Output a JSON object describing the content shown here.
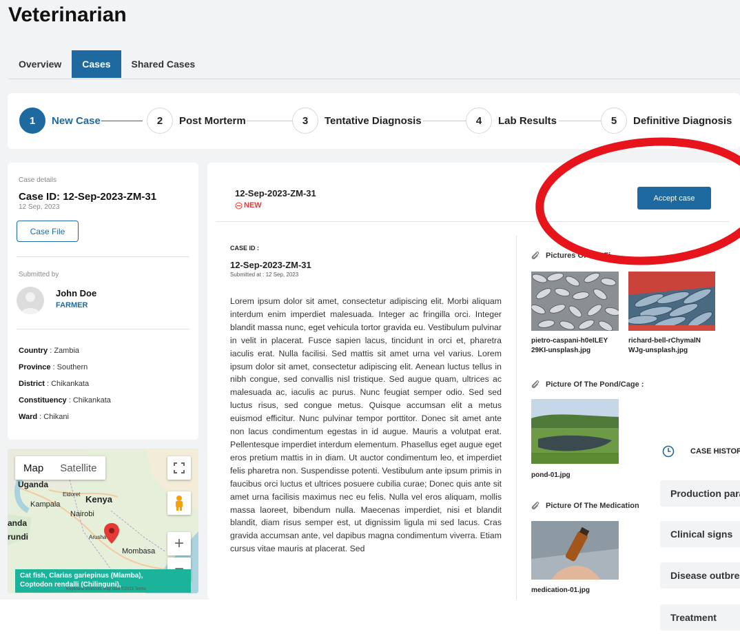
{
  "page": {
    "title": "Veterinarian"
  },
  "tabs": [
    {
      "label": "Overview"
    },
    {
      "label": "Cases"
    },
    {
      "label": "Shared Cases"
    }
  ],
  "steps": [
    {
      "num": "1",
      "label": "New Case"
    },
    {
      "num": "2",
      "label": "Post Morterm"
    },
    {
      "num": "3",
      "label": "Tentative Diagnosis"
    },
    {
      "num": "4",
      "label": "Lab Results"
    },
    {
      "num": "5",
      "label": "Definitive Diagnosis"
    }
  ],
  "left": {
    "details_label": "Case details",
    "case_id_title": "Case ID: 12-Sep-2023-ZM-31",
    "date": "12 Sep, 2023",
    "case_file_button": "Case File",
    "submitted_by_label": "Submitted by",
    "user_name": "John Doe",
    "user_role": "FARMER",
    "location": [
      {
        "key": "Country",
        "value": "Zambia"
      },
      {
        "key": "Province",
        "value": "Southern"
      },
      {
        "key": "District",
        "value": "Chikankata"
      },
      {
        "key": "Constituency",
        "value": "Chikankata"
      },
      {
        "key": "Ward",
        "value": "Chikani"
      }
    ]
  },
  "map": {
    "tab_map": "Map",
    "tab_satellite": "Satellite",
    "labels": {
      "uganda": "Uganda",
      "eldoret": "Eldoret",
      "kenya": "Kenya",
      "kampala": "Kampala",
      "nairobi": "Nairobi",
      "rwanda": "anda",
      "burundi": "rundi",
      "arusha": "Arusha",
      "mombasa": "Mombasa"
    },
    "info_lines": [
      "Cat fish, Clarias gariepinus (Mlamba),",
      "Coptodon rendalli (Chilinguni),"
    ],
    "footer_text": "Keyboard shortcuts   Map data ©2023   Terms",
    "accent_pin": "#e53935"
  },
  "main": {
    "case_id": "12-Sep-2023-ZM-31",
    "status": "NEW",
    "accept_button": "Accept case",
    "case_id_label": "CASE ID :",
    "case_id_value": "12-Sep-2023-ZM-31",
    "submitted_at": "Submitted at : 12 Sep, 2023",
    "body": "Lorem ipsum dolor sit amet, consectetur adipiscing elit. Morbi aliquam interdum enim imperdiet malesuada. Integer ac fringilla orci. Integer blandit massa nunc, eget vehicula tortor gravida eu. Vestibulum pulvinar in velit in placerat. Fusce sapien lacus, tincidunt in orci et, pharetra iaculis erat. Nulla facilisi. Sed mattis sit amet urna vel varius. Lorem ipsum dolor sit amet, consectetur adipiscing elit. Aenean luctus tellus in nibh congue, sed convallis nisl tristique. Sed augue quam, ultrices ac malesuada ac, iaculis ac purus. Nunc feugiat semper odio. Sed sed luctus risus, sed congue metus. Quisque accumsan elit a metus euismod efficitur. Nunc pulvinar tempor porttitor. Donec sit amet ante non lacus condimentum egestas in id augue. Mauris a volutpat erat. Pellentesque imperdiet interdum elementum. Phasellus eget augue eget eros pretium mattis in in diam. Ut auctor condimentum leo, et imperdiet felis pharetra non. Suspendisse potenti. Vestibulum ante ipsum primis in faucibus orci luctus et ultrices posuere cubilia curae; Donec quis ante sit amet urna facilisis maximus nec eu felis. Nulla vel eros aliquam, mollis massa laoreet, bibendum nulla. Maecenas imperdiet, nisi et blandit blandit, diam risus semper est, ut dignissim ligula mi sed lacus. Cras gravida accumsan ante, vel dapibus magna condimentum viverra. Etiam cursus vitae mauris at placerat. Sed",
    "attachments": {
      "fish_heading": "Pictures Of The Fi",
      "fish_files": [
        "pietro-caspani-h0eILEY29KI-unsplash.jpg",
        "richard-bell-rChymalNWJg-unsplash.jpg"
      ],
      "fish_file1_lines": [
        "pietro-caspani-h0eILEY",
        "29KI-unsplash.jpg"
      ],
      "fish_file2_lines": [
        "richard-bell-rChymalN",
        "WJg-unsplash.jpg"
      ],
      "pond_heading": "Picture Of The Pond/Cage :",
      "pond_file": "pond-01.jpg",
      "medication_heading": "Picture Of The Medication",
      "medication_file": "medication-01.jpg"
    }
  },
  "history": {
    "title": "CASE HISTORY",
    "items": [
      "Production parameters",
      "Clinical signs",
      "Disease outbreak",
      "Treatment"
    ]
  },
  "annotation": {
    "color": "#e8141b"
  }
}
